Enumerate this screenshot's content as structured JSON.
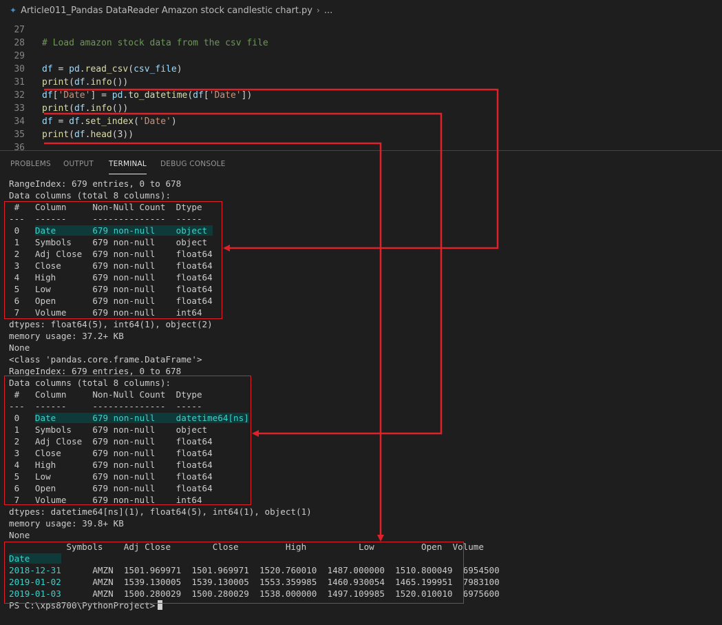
{
  "breadcrumb": {
    "file_icon": "python-file-icon",
    "file_name": "Article011_Pandas DataReader Amazon stock candlestic chart.py",
    "separator": "›",
    "ellipsis": "..."
  },
  "editor": {
    "lines": [
      {
        "n": "27",
        "parts": []
      },
      {
        "n": "28",
        "parts": [
          {
            "c": "cm",
            "t": "# Load amazon stock data from the csv file"
          }
        ]
      },
      {
        "n": "29",
        "parts": []
      },
      {
        "n": "30",
        "parts": [
          {
            "c": "vr",
            "t": "df"
          },
          {
            "c": "pl",
            "t": " = "
          },
          {
            "c": "vr",
            "t": "pd"
          },
          {
            "c": "pl",
            "t": "."
          },
          {
            "c": "fn",
            "t": "read_csv"
          },
          {
            "c": "pl",
            "t": "("
          },
          {
            "c": "vr",
            "t": "csv_file"
          },
          {
            "c": "pl",
            "t": ")"
          }
        ]
      },
      {
        "n": "31",
        "parts": [
          {
            "c": "fn",
            "t": "print"
          },
          {
            "c": "pl",
            "t": "("
          },
          {
            "c": "vr",
            "t": "df"
          },
          {
            "c": "pl",
            "t": "."
          },
          {
            "c": "fn",
            "t": "info"
          },
          {
            "c": "pl",
            "t": "())"
          }
        ]
      },
      {
        "n": "32",
        "parts": [
          {
            "c": "vr",
            "t": "df"
          },
          {
            "c": "pl",
            "t": "["
          },
          {
            "c": "st",
            "t": "'Date'"
          },
          {
            "c": "pl",
            "t": "] = "
          },
          {
            "c": "vr",
            "t": "pd"
          },
          {
            "c": "pl",
            "t": "."
          },
          {
            "c": "fn",
            "t": "to_datetime"
          },
          {
            "c": "pl",
            "t": "("
          },
          {
            "c": "vr",
            "t": "df"
          },
          {
            "c": "pl",
            "t": "["
          },
          {
            "c": "st",
            "t": "'Date'"
          },
          {
            "c": "pl",
            "t": "])"
          }
        ]
      },
      {
        "n": "33",
        "parts": [
          {
            "c": "fn",
            "t": "print"
          },
          {
            "c": "pl",
            "t": "("
          },
          {
            "c": "vr",
            "t": "df"
          },
          {
            "c": "pl",
            "t": "."
          },
          {
            "c": "fn",
            "t": "info"
          },
          {
            "c": "pl",
            "t": "())"
          }
        ]
      },
      {
        "n": "34",
        "parts": [
          {
            "c": "vr",
            "t": "df"
          },
          {
            "c": "pl",
            "t": " = "
          },
          {
            "c": "vr",
            "t": "df"
          },
          {
            "c": "pl",
            "t": "."
          },
          {
            "c": "fn",
            "t": "set_index"
          },
          {
            "c": "pl",
            "t": "("
          },
          {
            "c": "st",
            "t": "'Date'"
          },
          {
            "c": "pl",
            "t": ")"
          }
        ]
      },
      {
        "n": "35",
        "parts": [
          {
            "c": "fn",
            "t": "print"
          },
          {
            "c": "pl",
            "t": "("
          },
          {
            "c": "vr",
            "t": "df"
          },
          {
            "c": "pl",
            "t": "."
          },
          {
            "c": "fn",
            "t": "head"
          },
          {
            "c": "pl",
            "t": "("
          },
          {
            "c": "pl",
            "t": "3"
          },
          {
            "c": "pl",
            "t": "))"
          }
        ]
      },
      {
        "n": "36",
        "parts": []
      }
    ]
  },
  "panel_tabs": [
    {
      "label": "PROBLEMS",
      "active": false
    },
    {
      "label": "OUTPUT",
      "active": false
    },
    {
      "label": "TERMINAL",
      "active": true
    },
    {
      "label": "DEBUG CONSOLE",
      "active": false
    }
  ],
  "terminal": {
    "lines": [
      [
        {
          "t": "RangeIndex: 679 entries, 0 to 678"
        }
      ],
      [
        {
          "t": "Data columns (total 8 columns):"
        }
      ],
      [
        {
          "t": " #   Column     Non-Null Count  Dtype  "
        }
      ],
      [
        {
          "t": "---  ------     --------------  -----  "
        }
      ],
      [
        {
          "t": " 0   "
        },
        {
          "t": "Date       679 non-null    object ",
          "c": "hl"
        }
      ],
      [
        {
          "t": " 1   Symbols    679 non-null    object "
        }
      ],
      [
        {
          "t": " 2   Adj Close  679 non-null    float64"
        }
      ],
      [
        {
          "t": " 3   Close      679 non-null    float64"
        }
      ],
      [
        {
          "t": " 4   High       679 non-null    float64"
        }
      ],
      [
        {
          "t": " 5   Low        679 non-null    float64"
        }
      ],
      [
        {
          "t": " 6   Open       679 non-null    float64"
        }
      ],
      [
        {
          "t": " 7   Volume     679 non-null    int64  "
        }
      ],
      [
        {
          "t": "dtypes: float64(5), int64(1), object(2)"
        }
      ],
      [
        {
          "t": "memory usage: 37.2+ KB"
        }
      ],
      [
        {
          "t": "None"
        }
      ],
      [
        {
          "t": "<class 'pandas.core.frame.DataFrame'>"
        }
      ],
      [
        {
          "t": "RangeIndex: 679 entries, 0 to 678"
        }
      ],
      [
        {
          "t": "Data columns (total 8 columns):"
        }
      ],
      [
        {
          "t": " #   Column     Non-Null Count  Dtype         "
        }
      ],
      [
        {
          "t": "---  ------     --------------  -----         "
        }
      ],
      [
        {
          "t": " 0   "
        },
        {
          "t": "Date       679 non-null    datetime64[ns]",
          "c": "hl"
        }
      ],
      [
        {
          "t": " 1   Symbols    679 non-null    object        "
        }
      ],
      [
        {
          "t": " 2   Adj Close  679 non-null    float64       "
        }
      ],
      [
        {
          "t": " 3   Close      679 non-null    float64       "
        }
      ],
      [
        {
          "t": " 4   High       679 non-null    float64       "
        }
      ],
      [
        {
          "t": " 5   Low        679 non-null    float64       "
        }
      ],
      [
        {
          "t": " 6   Open       679 non-null    float64       "
        }
      ],
      [
        {
          "t": " 7   Volume     679 non-null    int64         "
        }
      ],
      [
        {
          "t": "dtypes: datetime64[ns](1), float64(5), int64(1), object(1)"
        }
      ],
      [
        {
          "t": "memory usage: 39.8+ KB"
        }
      ],
      [
        {
          "t": "None"
        }
      ],
      [
        {
          "t": "           Symbols    Adj Close        Close         High          Low         Open  Volume"
        }
      ],
      [
        {
          "t": "Date      ",
          "c": "hl"
        }
      ],
      [
        {
          "t": "2018-12-31",
          "c": "cy"
        },
        {
          "t": "      AMZN  1501.969971  1501.969971  1520.760010  1487.000000  1510.800049  6954500"
        }
      ],
      [
        {
          "t": "2019-01-02",
          "c": "cy"
        },
        {
          "t": "      AMZN  1539.130005  1539.130005  1553.359985  1460.930054  1465.199951  7983100"
        }
      ],
      [
        {
          "t": "2019-01-03",
          "c": "cy"
        },
        {
          "t": "      AMZN  1500.280029  1500.280029  1538.000000  1497.109985  1520.010010  6975600"
        }
      ]
    ],
    "prompt": "PS C:\\xps8700\\PythonProject>"
  },
  "colors": {
    "annotation_red": "#e0212a",
    "background": "#1e1e1e",
    "highlight_cyan": "#3fd0c8"
  }
}
